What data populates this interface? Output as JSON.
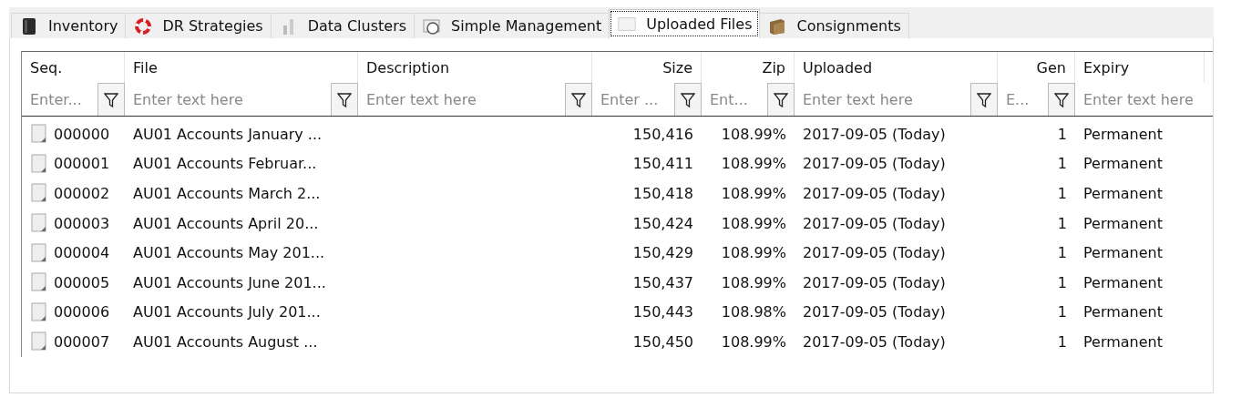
{
  "tabs": [
    {
      "label": "Inventory",
      "selected": false
    },
    {
      "label": "DR Strategies",
      "selected": false
    },
    {
      "label": "Data Clusters",
      "selected": false
    },
    {
      "label": "Simple Management",
      "selected": false
    },
    {
      "label": "Uploaded Files",
      "selected": true
    },
    {
      "label": "Consignments",
      "selected": false
    }
  ],
  "table": {
    "columns": [
      {
        "label": "Seq.",
        "kind": "text",
        "placeholder": "Enter...",
        "filter_button": true
      },
      {
        "label": "File",
        "kind": "text",
        "placeholder": "Enter text here",
        "filter_button": true
      },
      {
        "label": "Description",
        "kind": "text",
        "placeholder": "Enter text here",
        "filter_button": true
      },
      {
        "label": "Size",
        "kind": "number",
        "placeholder": "Enter ...",
        "filter_button": true
      },
      {
        "label": "Zip",
        "kind": "number",
        "placeholder": "Ent...",
        "filter_button": true
      },
      {
        "label": "Uploaded",
        "kind": "text",
        "placeholder": "Enter text here",
        "filter_button": true
      },
      {
        "label": "Gen",
        "kind": "number",
        "placeholder": "E...",
        "filter_button": true
      },
      {
        "label": "Expiry",
        "kind": "text",
        "placeholder": "Enter text here",
        "filter_button": false
      }
    ],
    "rows": [
      {
        "seq": "000000",
        "file": "AU01 Accounts January ...",
        "size": "150,416",
        "zip": "108.99%",
        "uploaded": "2017-09-05 (Today)",
        "gen": "1",
        "expiry": "Permanent"
      },
      {
        "seq": "000001",
        "file": "AU01 Accounts Februar...",
        "size": "150,411",
        "zip": "108.99%",
        "uploaded": "2017-09-05 (Today)",
        "gen": "1",
        "expiry": "Permanent"
      },
      {
        "seq": "000002",
        "file": "AU01 Accounts March 2...",
        "size": "150,418",
        "zip": "108.99%",
        "uploaded": "2017-09-05 (Today)",
        "gen": "1",
        "expiry": "Permanent"
      },
      {
        "seq": "000003",
        "file": "AU01 Accounts April 20...",
        "size": "150,424",
        "zip": "108.99%",
        "uploaded": "2017-09-05 (Today)",
        "gen": "1",
        "expiry": "Permanent"
      },
      {
        "seq": "000004",
        "file": "AU01 Accounts May 201...",
        "size": "150,429",
        "zip": "108.99%",
        "uploaded": "2017-09-05 (Today)",
        "gen": "1",
        "expiry": "Permanent"
      },
      {
        "seq": "000005",
        "file": "AU01 Accounts June 201...",
        "size": "150,437",
        "zip": "108.99%",
        "uploaded": "2017-09-05 (Today)",
        "gen": "1",
        "expiry": "Permanent"
      },
      {
        "seq": "000006",
        "file": "AU01 Accounts July 201...",
        "size": "150,443",
        "zip": "108.98%",
        "uploaded": "2017-09-05 (Today)",
        "gen": "1",
        "expiry": "Permanent"
      },
      {
        "seq": "000007",
        "file": "AU01 Accounts August ...",
        "size": "150,450",
        "zip": "108.99%",
        "uploaded": "2017-09-05 (Today)",
        "gen": "1",
        "expiry": "Permanent"
      }
    ]
  }
}
